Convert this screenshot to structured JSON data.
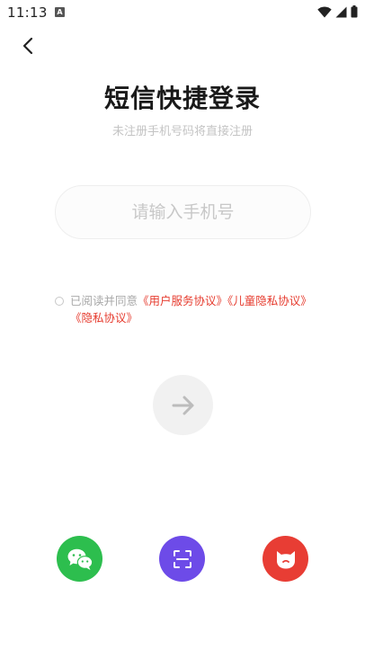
{
  "status_bar": {
    "time": "11:13",
    "notification_glyph": "A"
  },
  "title": "短信快捷登录",
  "subtitle": "未注册手机号码将直接注册",
  "phone_input": {
    "placeholder": "请输入手机号",
    "value": ""
  },
  "agreement": {
    "prefix": "已阅读并同意",
    "links": [
      "《用户服务协议》",
      "《儿童隐私协议》",
      "《隐私协议》"
    ]
  },
  "icons": {
    "back": "back-arrow-icon",
    "submit": "arrow-right-icon",
    "wechat": "wechat-icon",
    "scan": "scan-icon",
    "other": "cat-face-icon"
  },
  "colors": {
    "wechat": "#2dbe4e",
    "scan": "#6d4be8",
    "other": "#e83d34",
    "link": "#e63b2e",
    "submit_bg": "#f1f1f1"
  }
}
